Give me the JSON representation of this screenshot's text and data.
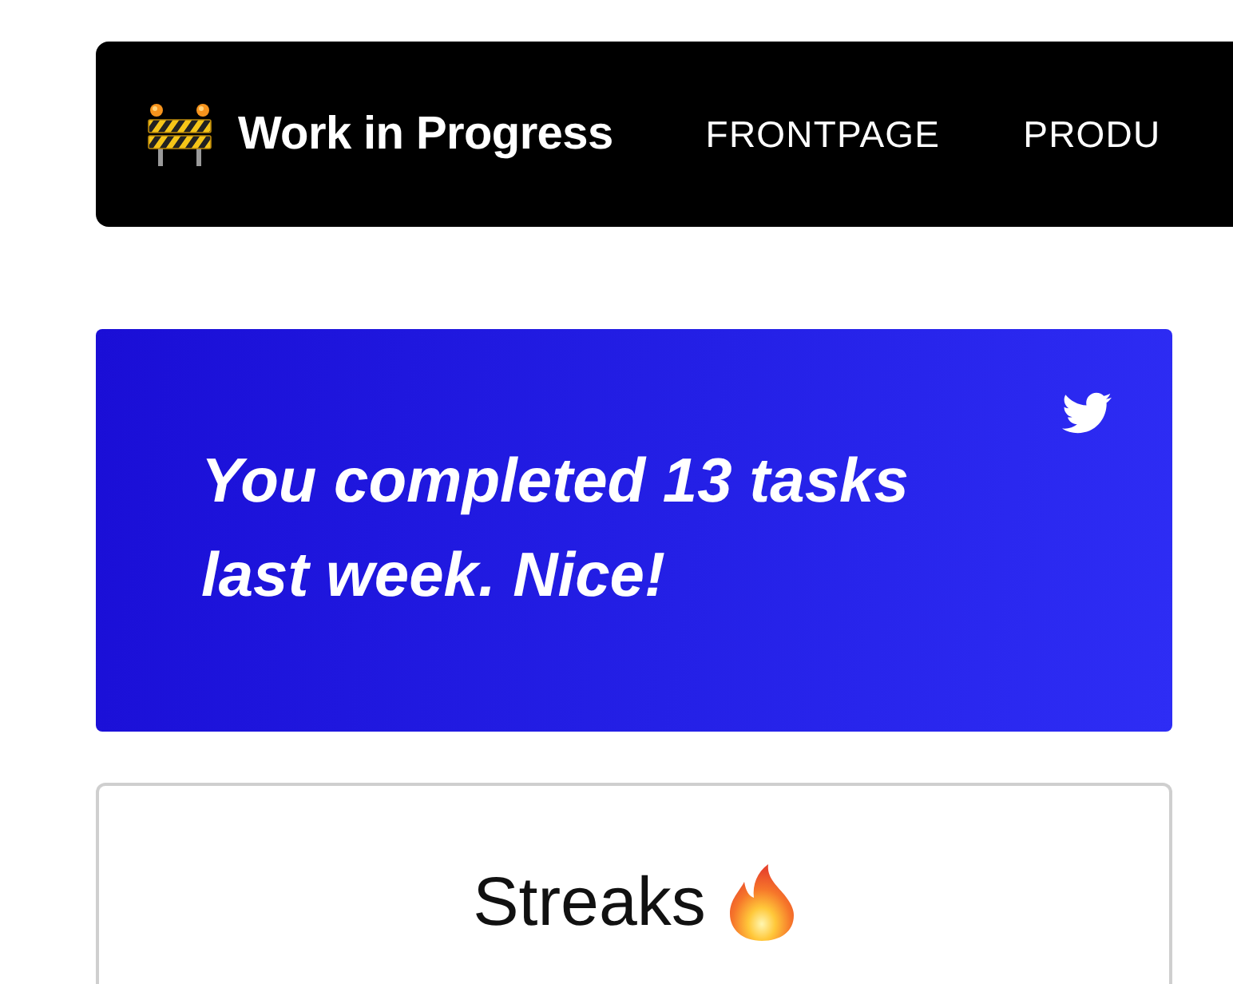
{
  "navbar": {
    "brand": "Work in Progress",
    "links": [
      {
        "label": "FRONTPAGE"
      },
      {
        "label": "PRODU"
      }
    ]
  },
  "banner": {
    "message": "You completed 13 tasks last week. Nice!"
  },
  "streaks_card": {
    "title": "Streaks"
  }
}
